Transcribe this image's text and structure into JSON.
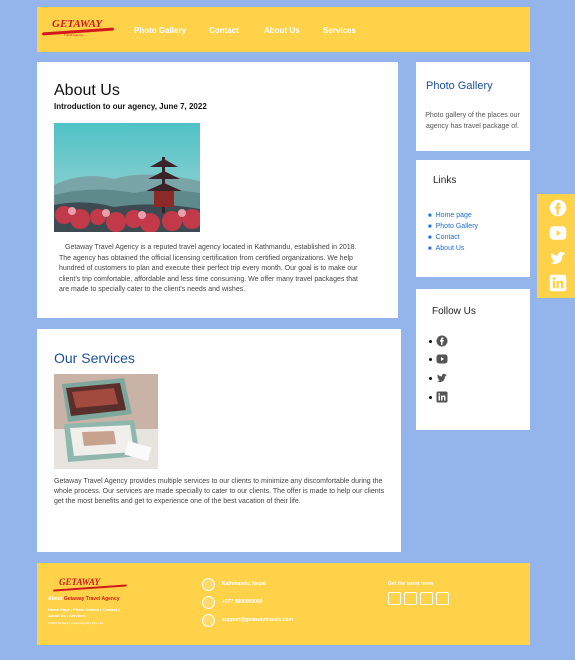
{
  "brand": {
    "logo_text": "GETAWAY",
    "logo_subtext": "Travel Agency"
  },
  "nav": {
    "photo_gallery": "Photo Gallery",
    "contact": "Contact",
    "about_us": "About Us",
    "services": "Services"
  },
  "about": {
    "title": "About Us",
    "subtitle": "Introduction to our agency, June 7, 2022",
    "body": "Getaway Travel Agency is a reputed travel agency located in Kathmandu, established in 2018. The agency has obtained the official licensing certification from certified organizations. We help hundred of customers to plan and execute their perfect trip every month. Our goal is to make our client's trip comfortable, affordable and less time consuming. We offer many travel packages that are made to specially cater to the client's needs and wishes."
  },
  "services": {
    "title": "Our Services",
    "body": "Getaway Travel Agency provides multiple services to our clients to minimize any discomfortable during the whole process. Our services are made specially to cater to our clients. The offer is made to help our clients get the most benefits and get to experience one of the best vacation of their life."
  },
  "sidebar": {
    "gallery": {
      "title": "Photo Gallery",
      "description": "Photo gallery of the places our agency has travel package of."
    },
    "links": {
      "title": "Links",
      "items": [
        "Home page",
        "Photo Gallery",
        "Contact",
        "About Us"
      ]
    },
    "follow": {
      "title": "Follow Us",
      "icons": [
        "facebook-icon",
        "youtube-icon",
        "twitter-icon",
        "linkedin-icon"
      ]
    }
  },
  "floating_social": [
    "facebook-icon",
    "youtube-icon",
    "twitter-icon",
    "linkedin-icon"
  ],
  "footer": {
    "about_prefix": "About",
    "about_name": "Getaway Travel Agency",
    "quick_links": "Home Page | Photo Gallery | Contact | About Us | Services",
    "copyright": "©2022 Getaway Travel Agency Pvt. Ltd.",
    "address": "Kathmandu, Nepal",
    "phone": "+977 9800000000",
    "email": "support@getawaytravels.com",
    "social_title": "Get the latest news",
    "social_icons": [
      "facebook-icon",
      "youtube-icon",
      "twitter-icon",
      "instagram-icon"
    ]
  },
  "colors": {
    "header": "#ffd24a",
    "background": "#93b5ec",
    "accent_blue": "#1b4f9c",
    "link": "#1e6fd0",
    "brand_red": "#d11b1b"
  }
}
